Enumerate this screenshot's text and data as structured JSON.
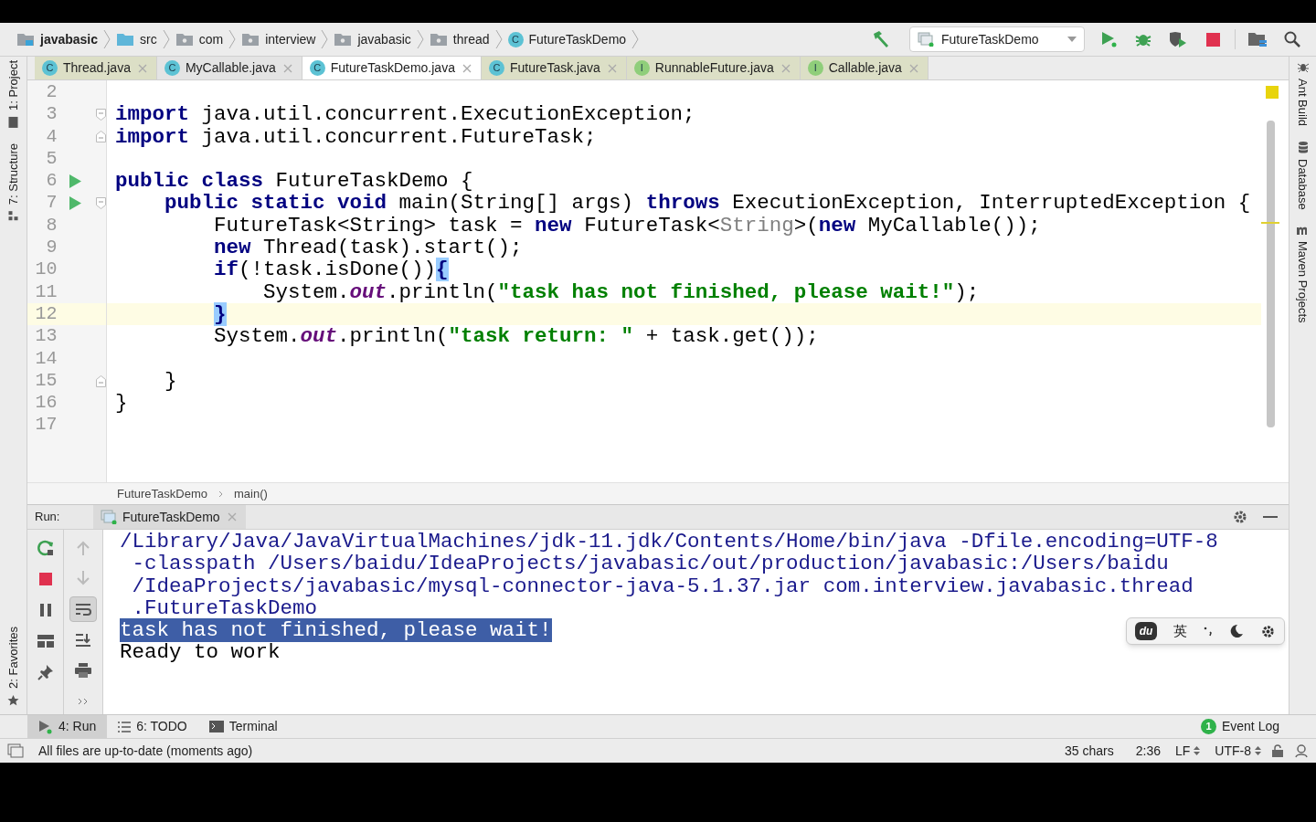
{
  "breadcrumbs": [
    {
      "label": "javabasic",
      "kind": "module"
    },
    {
      "label": "src",
      "kind": "source"
    },
    {
      "label": "com",
      "kind": "package"
    },
    {
      "label": "interview",
      "kind": "package"
    },
    {
      "label": "javabasic",
      "kind": "package"
    },
    {
      "label": "thread",
      "kind": "package"
    },
    {
      "label": "FutureTaskDemo",
      "kind": "class",
      "letter": "C"
    }
  ],
  "run_config": {
    "label": "FutureTaskDemo"
  },
  "tabs": [
    {
      "label": "Thread.java",
      "letter": "C",
      "kind": "class",
      "library": true,
      "selected": false
    },
    {
      "label": "MyCallable.java",
      "letter": "C",
      "kind": "class",
      "library": false,
      "selected": false
    },
    {
      "label": "FutureTaskDemo.java",
      "letter": "C",
      "kind": "class",
      "selected": true
    },
    {
      "label": "FutureTask.java",
      "letter": "C",
      "kind": "class",
      "library": true,
      "selected": false
    },
    {
      "label": "RunnableFuture.java",
      "letter": "I",
      "kind": "interface",
      "library": true,
      "selected": false
    },
    {
      "label": "Callable.java",
      "letter": "I",
      "kind": "interface",
      "library": true,
      "selected": false
    }
  ],
  "left_tools": [
    {
      "label": "1: Project",
      "kind": "folder"
    },
    {
      "label": "7: Structure",
      "kind": "structure"
    }
  ],
  "left_tools_bottom": [
    {
      "label": "2: Favorites",
      "kind": "star"
    }
  ],
  "right_tools": [
    {
      "label": "Ant Build",
      "kind": "ant"
    },
    {
      "label": "Database",
      "kind": "database"
    },
    {
      "label": "Maven Projects",
      "kind": "maven"
    }
  ],
  "code": [
    {
      "n": "2",
      "current": false,
      "run": false,
      "fold_start": false,
      "fold_end": false
    },
    {
      "n": "3",
      "current": false,
      "run": false,
      "fold_start": true,
      "fold_end": false,
      "tokens": [
        {
          "kind": "kw",
          "text": "import"
        },
        {
          "kind": "plain",
          "text": " java.util.concurrent.ExecutionException;"
        }
      ]
    },
    {
      "n": "4",
      "current": false,
      "run": false,
      "fold_start": false,
      "fold_end": true,
      "tokens": [
        {
          "kind": "kw",
          "text": "import"
        },
        {
          "kind": "plain",
          "text": " java.util.concurrent.FutureTask;"
        }
      ]
    },
    {
      "n": "5",
      "current": false,
      "run": false,
      "fold_start": false,
      "fold_end": false
    },
    {
      "n": "6",
      "current": false,
      "run": true,
      "fold_start": false,
      "fold_end": false,
      "tokens": [
        {
          "kind": "kw",
          "text": "public class"
        },
        {
          "kind": "plain",
          "text": " FutureTaskDemo {"
        }
      ]
    },
    {
      "n": "7",
      "current": false,
      "run": true,
      "fold_start": true,
      "fold_end": false,
      "tokens": [
        {
          "kind": "kw",
          "text": "    public static void"
        },
        {
          "kind": "plain",
          "text": " main(String[] args) "
        },
        {
          "kind": "kw",
          "text": "throws"
        },
        {
          "kind": "plain",
          "text": " ExecutionException, InterruptedException {"
        }
      ]
    },
    {
      "n": "8",
      "current": false,
      "run": false,
      "fold_start": false,
      "fold_end": false,
      "tokens": [
        {
          "kind": "plain",
          "text": "        FutureTask<String> task = "
        },
        {
          "kind": "kw",
          "text": "new"
        },
        {
          "kind": "plain",
          "text": " FutureTask<"
        },
        {
          "kind": "inferred",
          "text": "String"
        },
        {
          "kind": "plain",
          "text": ">("
        },
        {
          "kind": "kw",
          "text": "new"
        },
        {
          "kind": "plain",
          "text": " MyCallable());"
        }
      ]
    },
    {
      "n": "9",
      "current": false,
      "run": false,
      "fold_start": false,
      "fold_end": false,
      "tokens": [
        {
          "kind": "kw",
          "text": "        new"
        },
        {
          "kind": "plain",
          "text": " Thread(task).start();"
        }
      ]
    },
    {
      "n": "10",
      "current": false,
      "run": false,
      "fold_start": false,
      "fold_end": false,
      "tokens": [
        {
          "kind": "kw",
          "text": "        if"
        },
        {
          "kind": "plain",
          "text": "(!task.isDone())"
        },
        {
          "kind": "brace",
          "text": "{"
        }
      ]
    },
    {
      "n": "11",
      "current": false,
      "run": false,
      "fold_start": false,
      "fold_end": false,
      "tokens": [
        {
          "kind": "plain",
          "text": "            System."
        },
        {
          "kind": "field",
          "text": "out"
        },
        {
          "kind": "plain",
          "text": ".println("
        },
        {
          "kind": "str",
          "text": "\"task has not finished, please wait!\""
        },
        {
          "kind": "plain",
          "text": ");"
        }
      ]
    },
    {
      "n": "12",
      "current": true,
      "run": false,
      "fold_start": false,
      "fold_end": false,
      "tokens": [
        {
          "kind": "brace",
          "text": "        }"
        }
      ]
    },
    {
      "n": "13",
      "current": false,
      "run": false,
      "fold_start": false,
      "fold_end": false,
      "tokens": [
        {
          "kind": "plain",
          "text": "        System."
        },
        {
          "kind": "field",
          "text": "out"
        },
        {
          "kind": "plain",
          "text": ".println("
        },
        {
          "kind": "str",
          "text": "\"task return: \""
        },
        {
          "kind": "plain",
          "text": " + task.get());"
        }
      ]
    },
    {
      "n": "14",
      "current": false,
      "run": false,
      "fold_start": false,
      "fold_end": false
    },
    {
      "n": "15",
      "current": false,
      "run": false,
      "fold_start": false,
      "fold_end": true,
      "tokens": [
        {
          "kind": "plain",
          "text": "    }"
        }
      ]
    },
    {
      "n": "16",
      "current": false,
      "run": false,
      "fold_start": false,
      "fold_end": false,
      "tokens": [
        {
          "kind": "plain",
          "text": "}"
        }
      ]
    },
    {
      "n": "17",
      "current": false,
      "run": false,
      "fold_start": false,
      "fold_end": false
    }
  ],
  "editor_breadcrumbs": [
    "FutureTaskDemo",
    "main()"
  ],
  "run_panel": {
    "label": "Run:",
    "tab": "FutureTaskDemo"
  },
  "console": [
    {
      "kind": "cmd",
      "selected": false,
      "text": "/Library/Java/JavaVirtualMachines/jdk-11.jdk/Contents/Home/bin/java -Dfile.encoding=UTF-8"
    },
    {
      "kind": "cmd",
      "selected": false,
      "text": " -classpath /Users/baidu/IdeaProjects/javabasic/out/production/javabasic:/Users/baidu"
    },
    {
      "kind": "cmd",
      "selected": false,
      "text": " /IdeaProjects/javabasic/mysql-connector-java-5.1.37.jar com.interview.javabasic.thread"
    },
    {
      "kind": "cmd",
      "selected": false,
      "text": " .FutureTaskDemo"
    },
    {
      "kind": "out",
      "selected": true,
      "text": "task has not finished, please wait!"
    },
    {
      "kind": "out",
      "selected": false,
      "text": "Ready to work"
    }
  ],
  "ime": {
    "logo": "du",
    "mode": "英"
  },
  "tool_tabs": [
    {
      "label": "4: Run",
      "kind": "run",
      "selected": true
    },
    {
      "label": "6: TODO",
      "kind": "todo",
      "selected": false
    },
    {
      "label": "Terminal",
      "kind": "terminal",
      "selected": false
    }
  ],
  "event_log": {
    "count": "1",
    "label": "Event Log"
  },
  "status": {
    "message": "All files are up-to-date (moments ago)",
    "chars": "35 chars",
    "position": "2:36",
    "line_sep": "LF",
    "encoding": "UTF-8"
  }
}
